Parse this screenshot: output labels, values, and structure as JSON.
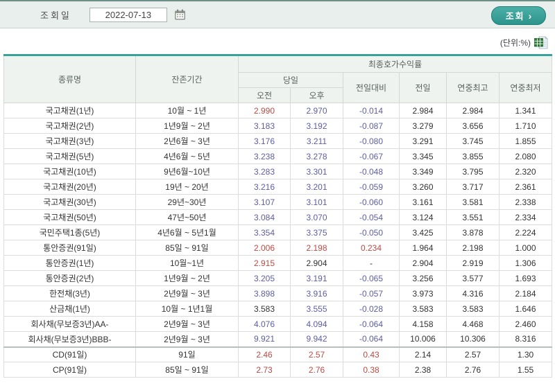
{
  "toolbar": {
    "date_label": "조회일",
    "date_value": "2022-07-13",
    "search_button_label": "조회",
    "search_button_chevron": "›"
  },
  "unit_note": "(단위:%)",
  "colors": {
    "up": "#bd4a44",
    "down": "#5d5da4",
    "flat": "#333333",
    "muted_purple": "#8d80a8",
    "muted_gray": "#9c9c9c",
    "accent_teal": "#2f968f"
  },
  "table": {
    "header": {
      "col_type": "종류명",
      "col_maturity": "잔존기간",
      "group_yield": "최종호가수익률",
      "group_today": "당일",
      "col_am": "오전",
      "col_pm": "오후",
      "col_change": "전일대비",
      "col_prev": "전일",
      "col_year_high": "연중최고",
      "col_year_low": "연중최저"
    },
    "rows": [
      {
        "name": "국고채권(1년)",
        "maturity": "10월 ~ 1년",
        "am": "2.990",
        "pm": "2.970",
        "chg": "-0.014",
        "prev": "2.984",
        "high": "2.984",
        "low": "1.341",
        "am_c": "up",
        "pm_c": "down",
        "chg_c": "down"
      },
      {
        "name": "국고채권(2년)",
        "maturity": "1년9월 ~ 2년",
        "am": "3.183",
        "pm": "3.192",
        "chg": "-0.087",
        "prev": "3.279",
        "high": "3.656",
        "low": "1.710",
        "am_c": "down",
        "pm_c": "down",
        "chg_c": "down"
      },
      {
        "name": "국고채권(3년)",
        "maturity": "2년6월 ~ 3년",
        "am": "3.176",
        "pm": "3.211",
        "chg": "-0.080",
        "prev": "3.291",
        "high": "3.745",
        "low": "1.855",
        "am_c": "down",
        "pm_c": "down",
        "chg_c": "down"
      },
      {
        "name": "국고채권(5년)",
        "maturity": "4년6월 ~ 5년",
        "am": "3.238",
        "pm": "3.278",
        "chg": "-0.067",
        "prev": "3.345",
        "high": "3.855",
        "low": "2.080",
        "am_c": "down",
        "pm_c": "down",
        "chg_c": "down"
      },
      {
        "name": "국고채권(10년)",
        "maturity": "9년6월~10년",
        "am": "3.283",
        "pm": "3.301",
        "chg": "-0.048",
        "prev": "3.349",
        "high": "3.795",
        "low": "2.320",
        "am_c": "down",
        "pm_c": "down",
        "chg_c": "down"
      },
      {
        "name": "국고채권(20년)",
        "maturity": "19년 ~ 20년",
        "am": "3.216",
        "pm": "3.201",
        "chg": "-0.059",
        "prev": "3.260",
        "high": "3.717",
        "low": "2.361",
        "am_c": "down",
        "pm_c": "down",
        "chg_c": "down"
      },
      {
        "name": "국고채권(30년)",
        "maturity": "29년~30년",
        "am": "3.107",
        "pm": "3.101",
        "chg": "-0.060",
        "prev": "3.161",
        "high": "3.581",
        "low": "2.338",
        "am_c": "down",
        "pm_c": "down",
        "chg_c": "down"
      },
      {
        "name": "국고채권(50년)",
        "maturity": "47년~50년",
        "am": "3.084",
        "pm": "3.070",
        "chg": "-0.054",
        "prev": "3.124",
        "high": "3.551",
        "low": "2.334",
        "am_c": "down",
        "pm_c": "down",
        "chg_c": "down"
      },
      {
        "name": "국민주택1종(5년)",
        "maturity": "4년6월 ~ 5년1월",
        "am": "3.354",
        "pm": "3.375",
        "chg": "-0.050",
        "prev": "3.425",
        "high": "3.878",
        "low": "2.224",
        "am_c": "down",
        "pm_c": "down",
        "chg_c": "down"
      },
      {
        "name": "통안증권(91일)",
        "maturity": "85일 ~ 91일",
        "am": "2.006",
        "pm": "2.198",
        "chg": "0.234",
        "prev": "1.964",
        "high": "2.198",
        "low": "1.000",
        "am_c": "up",
        "pm_c": "up",
        "chg_c": "up"
      },
      {
        "name": "통안증권(1년)",
        "maturity": "10월~1년",
        "am": "2.915",
        "pm": "2.904",
        "chg": "-",
        "prev": "2.904",
        "high": "2.919",
        "low": "1.306",
        "am_c": "up",
        "pm_c": "flat",
        "chg_c": "flat"
      },
      {
        "name": "통안증권(2년)",
        "maturity": "1년9월 ~ 2년",
        "am": "3.205",
        "pm": "3.191",
        "chg": "-0.065",
        "prev": "3.256",
        "high": "3.577",
        "low": "1.693",
        "am_c": "down",
        "pm_c": "down",
        "chg_c": "down"
      },
      {
        "name": "한전채(3년)",
        "maturity": "2년9월 ~ 3년",
        "am": "3.898",
        "pm": "3.916",
        "chg": "-0.057",
        "prev": "3.973",
        "high": "4.316",
        "low": "2.184",
        "am_c": "down",
        "pm_c": "down",
        "chg_c": "down"
      },
      {
        "name": "산금채(1년)",
        "maturity": "10월 ~ 1년1월",
        "am": "3.583",
        "pm": "3.555",
        "chg": "-0.028",
        "prev": "3.583",
        "high": "3.583",
        "low": "1.646",
        "am_c": "flat",
        "pm_c": "down",
        "chg_c": "down"
      },
      {
        "name": "회사채(무보증3년)AA-",
        "maturity": "2년9월 ~ 3년",
        "am": "4.076",
        "pm": "4.094",
        "chg": "-0.064",
        "prev": "4.158",
        "high": "4.468",
        "low": "2.460",
        "am_c": "down",
        "pm_c": "down",
        "chg_c": "down"
      },
      {
        "name": "회사채(무보증3년)BBB-",
        "maturity": "2년9월 ~ 3년",
        "am": "9.921",
        "pm": "9.942",
        "chg": "-0.064",
        "prev": "10.006",
        "high": "10.306",
        "low": "8.316",
        "am_c": "down",
        "pm_c": "down",
        "chg_c": "down"
      },
      {
        "name": "CD(91일)",
        "maturity": "91일",
        "am": "2.46",
        "pm": "2.57",
        "chg": "0.43",
        "prev": "2.14",
        "high": "2.57",
        "low": "1.30",
        "am_c": "up",
        "pm_c": "up",
        "chg_c": "up",
        "section_start": true
      },
      {
        "name": "CP(91일)",
        "maturity": "85일 ~ 91일",
        "am": "2.73",
        "pm": "2.76",
        "chg": "0.38",
        "prev": "2.38",
        "high": "2.76",
        "low": "1.55",
        "am_c": "up",
        "pm_c": "up",
        "chg_c": "up"
      }
    ]
  }
}
